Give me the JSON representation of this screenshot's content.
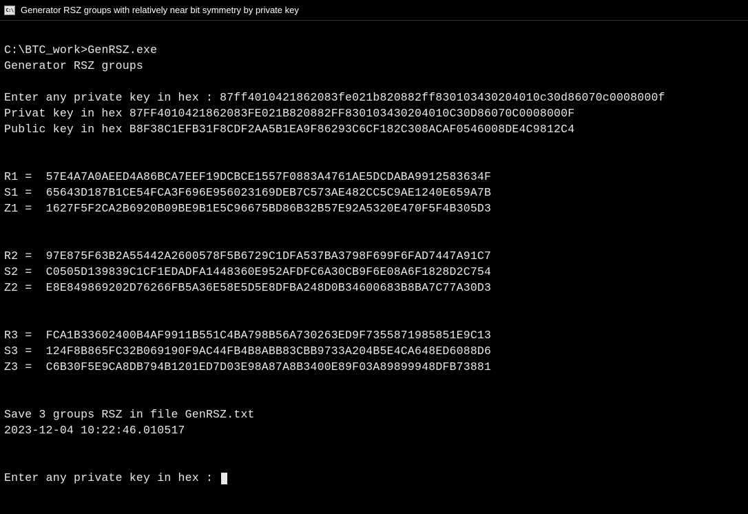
{
  "window": {
    "title": "Generator RSZ groups with relatively near bit symmetry by private key",
    "icon_label": "C:\\"
  },
  "prompt_path": "C:\\BTC_work>",
  "command": "GenRSZ.exe",
  "header_line": "Generator RSZ groups",
  "input_prompt": "Enter any private key in hex : ",
  "input_value": "87ff4010421862083fe021b820882ff830103430204010c30d86070c0008000f",
  "priv_label": "Privat key in hex ",
  "priv_value": "87FF4010421862083FE021B820882FF830103430204010C30D86070C0008000F",
  "pub_label": "Public key in hex ",
  "pub_value": "B8F38C1EFB31F8CDF2AA5B1EA9F86293C6CF182C308ACAF0546008DE4C9812C4",
  "groups": [
    {
      "r_label": "R1 =  ",
      "r_value": "57E4A7A0AEED4A86BCA7EEF19DCBCE1557F0883A4761AE5DCDABA9912583634F",
      "s_label": "S1 =  ",
      "s_value": "65643D187B1CE54FCA3F696E956023169DEB7C573AE482CC5C9AE1240E659A7B",
      "z_label": "Z1 =  ",
      "z_value": "1627F5F2CA2B6920B09BE9B1E5C96675BD86B32B57E92A5320E470F5F4B305D3"
    },
    {
      "r_label": "R2 =  ",
      "r_value": "97E875F63B2A55442A2600578F5B6729C1DFA537BA3798F699F6FAD7447A91C7",
      "s_label": "S2 =  ",
      "s_value": "C0505D139839C1CF1EDADFA1448360E952AFDFC6A30CB9F6E08A6F1828D2C754",
      "z_label": "Z2 =  ",
      "z_value": "E8E849869202D76266FB5A36E58E5D5E8DFBA248D0B34600683B8BA7C77A30D3"
    },
    {
      "r_label": "R3 =  ",
      "r_value": "FCA1B33602400B4AF9911B551C4BA798B56A730263ED9F7355871985851E9C13",
      "s_label": "S3 =  ",
      "s_value": "124F8B865FC32B069190F9AC44FB4B8ABB83CBB9733A204B5E4CA648ED6088D6",
      "z_label": "Z3 =  ",
      "z_value": "C6B30F5E9CA8DB794B1201ED7D03E98A87A8B3400E89F03A89899948DFB73881"
    }
  ],
  "save_line": "Save 3 groups RSZ in file GenRSZ.txt",
  "timestamp": "2023-12-04 10:22:46.010517",
  "next_prompt": "Enter any private key in hex : "
}
